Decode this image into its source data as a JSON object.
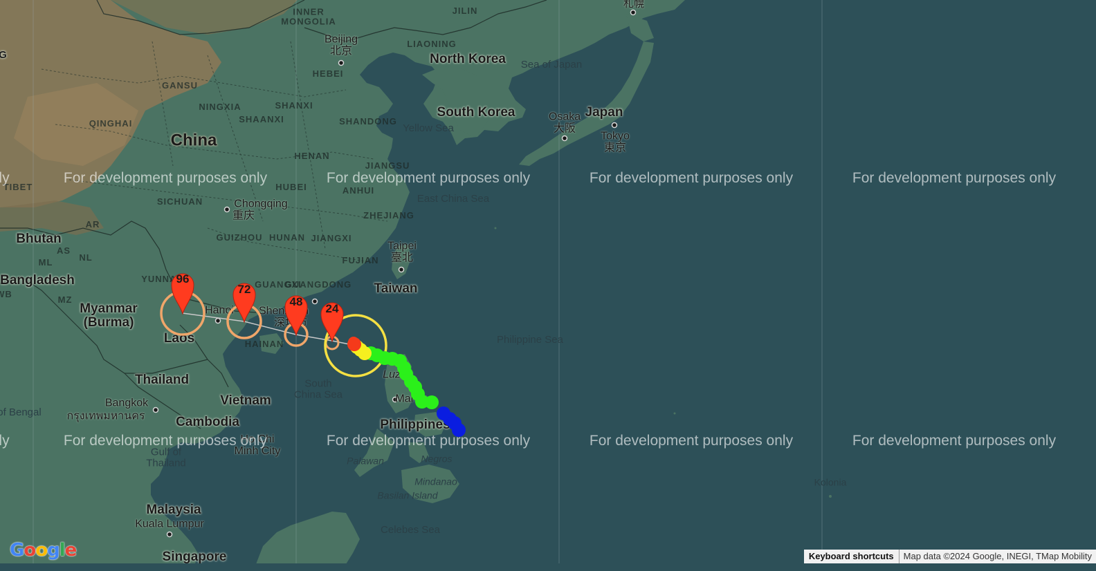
{
  "map": {
    "colors": {
      "water": "#2d5058",
      "land": "#4b7363",
      "desert": "#8a7857",
      "track_line": "#c8c8c8",
      "pin": "#ff3b1f",
      "orange_ring": "#f0a66a",
      "yellow_ring": "#f5e043"
    },
    "labels": {
      "inner_mongolia": "INNER\nMONGOLIA",
      "jilin": "JILIN",
      "sapporo": "札幌",
      "beijing": "Beijing",
      "beijing_cn": "北京",
      "liaoning": "LIAONING",
      "north_korea": "North Korea",
      "sea_of_japan": "Sea of Japan",
      "hebei": "HEBEI",
      "gansu": "GANSU",
      "ningxia": "NINGXIA",
      "shanxi": "SHANXI",
      "south_korea": "South Korea",
      "osaka": "Osaka",
      "osaka_jp": "大阪",
      "japan": "Japan",
      "qinghai": "QINGHAI",
      "shaanxi": "SHAANXI",
      "shandong": "SHANDONG",
      "yellow_sea": "Yellow Sea",
      "tokyo": "Tokyo",
      "tokyo_jp": "東京",
      "china": "China",
      "henan": "HENAN",
      "jiangsu": "JIANGSU",
      "tibet": "TIBET",
      "hubei": "HUBEI",
      "anhui": "ANHUI",
      "east_china_sea": "East China Sea",
      "sichuan": "SICHUAN",
      "chongqing": "Chongqing",
      "chongqing_cn": "重庆",
      "zhejiang": "ZHEJIANG",
      "ar": "AR",
      "bhutan": "Bhutan",
      "as": "AS",
      "nl": "NL",
      "ml": "ML",
      "guizhou": "GUIZHOU",
      "hunan": "HUNAN",
      "jiangxi": "JIANGXI",
      "taipei": "Taipei",
      "taipei_cn": "臺北",
      "fujian": "FUJIAN",
      "bangladesh": "Bangladesh",
      "wb": "WB",
      "yunnan": "YUNNAN",
      "guangxi": "GUANGXI",
      "guangdong": "GUANGDONG",
      "taiwan": "Taiwan",
      "mz": "MZ",
      "myanmar": "Myanmar\n(Burma)",
      "hanoi": "Hanoi",
      "shenzhen": "Shenzhen",
      "shenzhen_cn": "深圳市",
      "philippine_sea": "Philippine Sea",
      "laos": "Laos",
      "hainan": "HAINAN",
      "luzon": "Luzon",
      "south_china_sea": "South\nChina Sea",
      "manila": "Manila",
      "thailand": "Thailand",
      "vietnam": "Vietnam",
      "bangkok": "Bangkok",
      "bangkok_th": "กรุงเทพมหานคร",
      "bay_of_bengal": "of Bengal",
      "cambodia": "Cambodia",
      "philippines": "Philippines",
      "ho_chi_minh": "Ho Chi\nMinh City",
      "gulf_of_thailand": "Gulf of\nThailand",
      "palawan": "Palawan",
      "negros": "Negros",
      "mindanao": "Mindanao",
      "basilan": "Basilan Island",
      "kolonia": "Kolonia",
      "malaysia": "Malaysia",
      "kuala_lumpur": "Kuala Lumpur",
      "celebes_sea": "Celebes Sea",
      "singapore": "Singapore",
      "edge_ly": "ly",
      "edge_g": "G"
    },
    "watermark": "For development purposes only",
    "forecast_pins": [
      "96",
      "72",
      "48",
      "24"
    ],
    "track_legend": {
      "observed_intensity_colors": [
        "#0a1de0",
        "#2bf01a",
        "#f5ef1f",
        "#f53a1a"
      ]
    }
  },
  "footer": {
    "keyboard_shortcuts": "Keyboard shortcuts",
    "attribution": "Map data ©2024 Google, INEGI, TMap Mobility"
  },
  "logo": {
    "letters": [
      "G",
      "o",
      "o",
      "g",
      "l",
      "e"
    ],
    "colors": [
      "#4285f4",
      "#ea4335",
      "#fbbc05",
      "#4285f4",
      "#34a853",
      "#ea4335"
    ]
  }
}
